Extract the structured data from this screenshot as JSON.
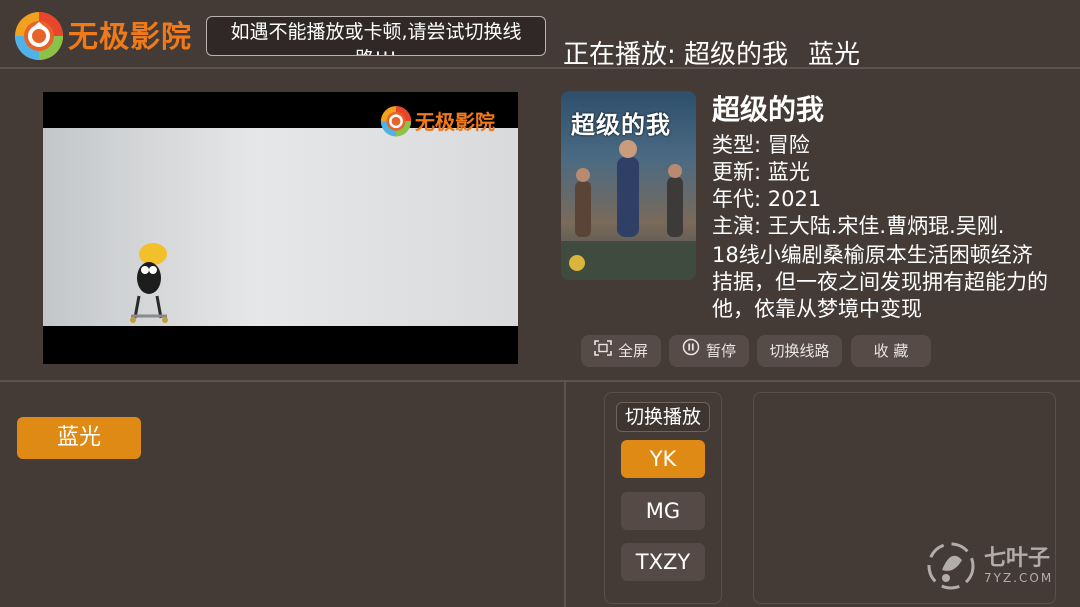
{
  "header": {
    "logo_text": "无极影院",
    "notice": "如遇不能播放或卡顿,请尝试切换线路!!!",
    "now_playing_label": "正在播放: 超级的我",
    "now_playing_episode": "蓝光"
  },
  "player": {
    "watermark": "无极影院"
  },
  "movie": {
    "poster_title": "超级的我",
    "title": "超级的我",
    "type": "类型: 冒险",
    "update": "更新: 蓝光",
    "year": "年代: 2021",
    "cast": "主演: 王大陆.宋佳.曹炳琨.吴刚.",
    "description": "18线小编剧桑榆原本生活困顿经济拮据，但一夜之间发现拥有超能力的他，依靠从梦境中变现"
  },
  "controls": {
    "fullscreen": "全屏",
    "pause": "暂停",
    "switch_line": "切换线路",
    "favorite": "收 藏"
  },
  "episodes": [
    {
      "label": "蓝光",
      "selected": true
    }
  ],
  "sources": {
    "title": "切换播放",
    "items": [
      {
        "label": "YK",
        "active": true
      },
      {
        "label": "MG",
        "active": false
      },
      {
        "label": "TXZY",
        "active": false
      }
    ]
  },
  "corner_watermark": {
    "name": "七叶子",
    "url": "7YZ.COM"
  },
  "colors": {
    "background": "#443a36",
    "accent": "#e08a16",
    "brand": "#f07a1a"
  }
}
